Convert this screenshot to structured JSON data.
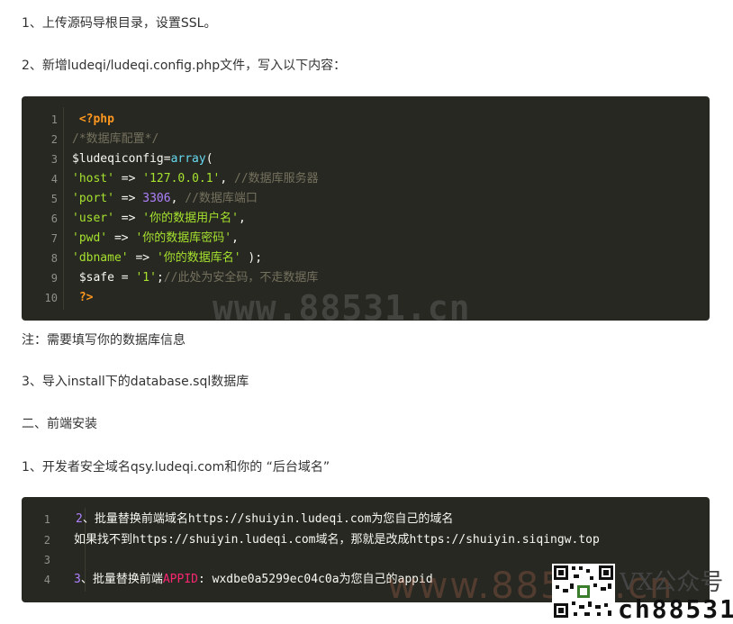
{
  "paragraphs": {
    "p1": "1、上传源码导根目录，设置SSL。",
    "p2": "2、新增ludeqi/ludeqi.config.php文件，写入以下内容：",
    "note": "注：需要填写你的数据库信息",
    "p3": "3、导入install下的database.sql数据库",
    "section2": "二、前端安装",
    "p4": "1、开发者安全域名qsy.ludeqi.com和你的 “后台域名”"
  },
  "code_block_1": {
    "line_numbers": [
      "1",
      "2",
      "3",
      "4",
      "5",
      "6",
      "7",
      "8",
      "9",
      "10"
    ],
    "l1": {
      "indent": " ",
      "open": "<?php"
    },
    "l2": {
      "comment": "/*数据库配置*/"
    },
    "l3": {
      "var": "$ludeqiconfig",
      "eq": "=",
      "fn": "array",
      "paren": "("
    },
    "l4": {
      "key": "'host'",
      "arrow": " => ",
      "val": "'127.0.0.1'",
      "comma": ", ",
      "comment": "//数据库服务器"
    },
    "l5": {
      "key": "'port'",
      "arrow": " => ",
      "val": "3306",
      "comma": ", ",
      "comment": "//数据库端口"
    },
    "l6": {
      "key": "'user'",
      "arrow": " => ",
      "val": "'你的数据用户名'",
      "comma": ","
    },
    "l7": {
      "key": "'pwd'",
      "arrow": " => ",
      "val": "'你的数据库密码'",
      "comma": ","
    },
    "l8": {
      "key": "'dbname'",
      "arrow": " => ",
      "val": "'你的数据库名'",
      "comma": " );"
    },
    "l9": {
      "indent": " ",
      "var": "$safe",
      "eq": " = ",
      "val": "'1'",
      "semi": ";",
      "comment": "//此处为安全码，不走数据库"
    },
    "l10": {
      "indent": " ",
      "close": "?>"
    }
  },
  "code_block_2": {
    "line_numbers": [
      "1",
      "2",
      "3",
      "4"
    ],
    "l1": {
      "num": "2",
      "text": "、批量替换前端域名https://shuiyin.ludeqi.com为您自己的域名"
    },
    "l2": {
      "text": "如果找不到https://shuiyin.ludeqi.com域名，那就是改成https://shuiyin.siqingw.top"
    },
    "l4": {
      "num": "3",
      "text1": "、批量替换前端",
      "appid_label": "APPID",
      "text2": ": wxdbe0a5299ec04c0a为您自己的appid"
    }
  },
  "watermarks": {
    "center": "www.88531.cn",
    "bottom": "www.88531.cn",
    "brand_top": "VX公众号",
    "brand_bottom": "ch88531"
  },
  "colors": {
    "code_bg": "#272822",
    "keyword": "#fd971f",
    "comment": "#75715e",
    "string": "#a6e22e",
    "number": "#ae81ff",
    "function": "#66d9ef",
    "highlight_red": "#f92672"
  }
}
